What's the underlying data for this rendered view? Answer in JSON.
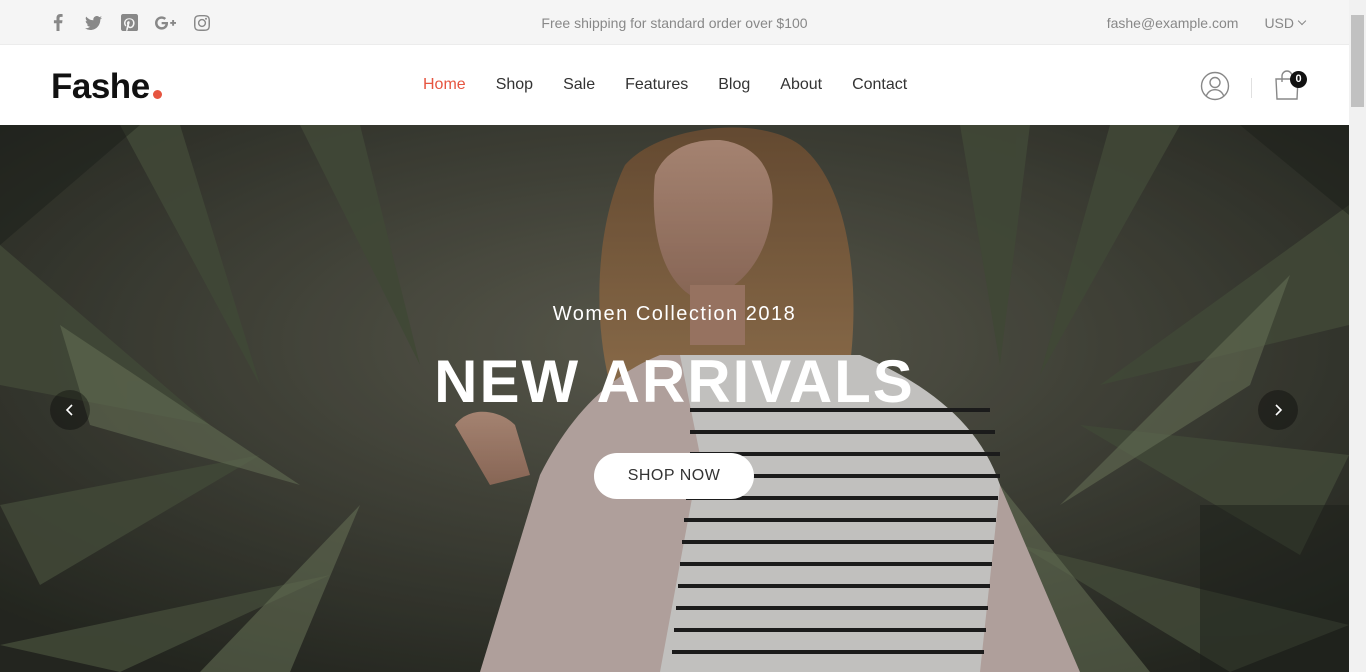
{
  "topbar": {
    "social_icons": [
      "facebook-icon",
      "twitter-icon",
      "pinterest-icon",
      "google-plus-icon",
      "instagram-icon"
    ],
    "message": "Free shipping for standard order over $100",
    "email": "fashe@example.com",
    "currency": "USD"
  },
  "header": {
    "logo": "Fashe",
    "nav": [
      {
        "label": "Home",
        "active": true
      },
      {
        "label": "Shop",
        "active": false
      },
      {
        "label": "Sale",
        "active": false
      },
      {
        "label": "Features",
        "active": false
      },
      {
        "label": "Blog",
        "active": false
      },
      {
        "label": "About",
        "active": false
      },
      {
        "label": "Contact",
        "active": false
      }
    ],
    "cart_count": "0"
  },
  "hero": {
    "subtitle": "Women Collection 2018",
    "title": "NEW ARRIVALS",
    "button_label": "SHOP NOW"
  },
  "colors": {
    "accent": "#e65540",
    "topbar_bg": "#f5f5f5",
    "text_dark": "#333333"
  }
}
